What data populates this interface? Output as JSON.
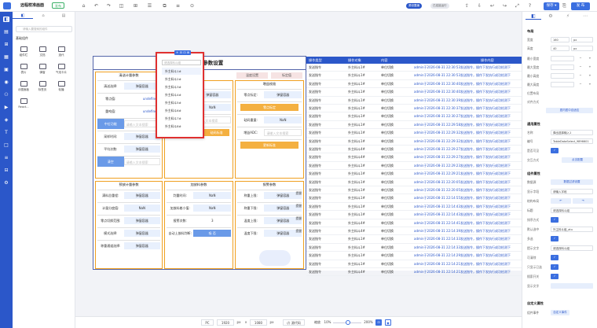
{
  "topbar": {
    "title": "远程校准画面",
    "badge": "发布",
    "view_label": "源设置编",
    "mode_label": "已连接运行",
    "save_label": "保存 ▾",
    "publish_label": "发 布"
  },
  "panel": {
    "search_placeholder": "请输入要搜索的组件",
    "section": "基础组件",
    "items": [
      "组件栏",
      "文档",
      "选代",
      "表片",
      "弹窗",
      "气泡卡片",
      "示图面板",
      "标签页",
      "轮播",
      "React..."
    ]
  },
  "frame": {
    "title": "称重标准与参数设置",
    "boxes": {
      "clear": {
        "title": "清送计量参数",
        "rows": [
          {
            "label": "清送选择:",
            "value": "弹窗容器",
            "style": "blue"
          },
          {
            "label": "零点值:",
            "value": "undefined",
            "style": "undef"
          },
          {
            "label": "重吨值:",
            "value": "undefined",
            "style": "undef"
          },
          {
            "label": "中位功能",
            "value": "请输入文本搜索",
            "style": "input",
            "lab": "blue"
          },
          {
            "label": "采样时间:",
            "value": "弹窗容器",
            "style": "blue"
          },
          {
            "label": "平均次数:",
            "value": "弹窗容器",
            "style": "blue"
          },
          {
            "label": "清空",
            "value": "请输入文本搜索",
            "style": "input",
            "lab": "blue"
          }
        ]
      },
      "mid": {
        "title": "过标准",
        "rows": [
          {
            "label": "",
            "value": "弹窗容器",
            "style": "blue"
          },
          {
            "label": "砝码重量:",
            "value": "NaN",
            "style": "blue"
          },
          {
            "label": "砝码ADC:",
            "value": "请输入文本搜索",
            "style": "input"
          },
          {
            "label": "零点标定",
            "value": "砝码标准",
            "style": "pair"
          }
        ]
      },
      "span": {
        "title": "增益校准",
        "rows": [
          {
            "label": "零点标定:",
            "value": "弹窗容器",
            "style": "blue"
          },
          {
            "label": "零点标定",
            "value": "",
            "style": "orangebar"
          },
          {
            "label": "砝码重量:",
            "value": "NaN",
            "style": "blue"
          },
          {
            "label": "增益ADC:",
            "value": "请输入文本搜索",
            "style": "input"
          },
          {
            "label": "更新标准",
            "value": "",
            "style": "orangebar"
          }
        ]
      },
      "pre": {
        "title": "预放计量参数",
        "rows": [
          {
            "label": "满料总重程:",
            "value": "弹窗容器",
            "style": "blue"
          },
          {
            "label": "计量分度值:",
            "value": "NaN",
            "style": "blue"
          },
          {
            "label": "零点切换范围:",
            "value": "弹窗容器",
            "style": "blue"
          },
          {
            "label": "模式选择:",
            "value": "弹窗容器",
            "style": "blue"
          },
          {
            "label": "称重通道选择:",
            "value": "弹窗容器",
            "style": "blue"
          }
        ]
      },
      "add": {
        "title": "加放料参数",
        "rows": [
          {
            "label": "判重时间:",
            "value": "NaN",
            "style": "blue"
          },
          {
            "label": "加放料着小值:",
            "value": "NaN",
            "style": "blue"
          },
          {
            "label": "报警次数:",
            "value": "3",
            "style": "plain"
          },
          {
            "label": "自动上放料判断:",
            "value": "吸 否",
            "style": "solid"
          }
        ]
      },
      "alarm": {
        "title": "报警参数",
        "rows": [
          {
            "label": "称重上限:",
            "value": "弹窗容器",
            "style": "blue"
          },
          {
            "label": "称重下限:",
            "value": "弹窗容器",
            "style": "blue"
          },
          {
            "label": "温度上限:",
            "value": "弹窗容器",
            "style": "blue"
          },
          {
            "label": "温度下限:",
            "value": "弹窗容器",
            "style": "blue"
          }
        ]
      }
    },
    "side_labels": [
      "提醒",
      "提醒",
      "提醒",
      "提醒",
      "提醒"
    ],
    "chip_labels": [
      "温度设置",
      "标定值"
    ]
  },
  "dropdown": {
    "toolbar": "+ ⊟ ⊡ ⊞",
    "search": "请选择料斗组",
    "items": [
      "外主料斗1#",
      "外主料斗2#",
      "外主料斗3#",
      "外主料斗4#",
      "外主料斗5#",
      "外主料斗6#",
      "外主料斗7#",
      "外主料斗8#"
    ]
  },
  "table": {
    "headers": [
      "操作类型",
      "操作对象",
      "内容",
      "",
      "操作内容"
    ],
    "rows": [
      [
        "发送指令",
        "外主料斗1#",
        "单位切换",
        "admin于2026-08-31 22:30:53发送指令，操作下发执行成功检测下"
      ],
      [
        "发送指令",
        "外主料斗1#",
        "单位切换",
        "admin于2026-08-31 22:30:53发送指令，操作下发执行成功检测下"
      ],
      [
        "发送指令",
        "外主料斗1#",
        "单位切换",
        "admin于2026-08-31 22:30:40发送指令，操作下发执行成功检测下"
      ],
      [
        "发送指令",
        "外主料斗1#",
        "单位切换",
        "admin于2026-08-31 22:30:40发送指令，操作下发执行成功检测下"
      ],
      [
        "发送指令",
        "外主料斗1#",
        "单位切换",
        "admin于2026-08-31 22:30:39发送指令，操作下发执行成功检测下"
      ],
      [
        "发送指令",
        "外主料斗1#",
        "单位切换",
        "admin于2026-08-31 22:30:37发送指令，操作下发执行成功检测下"
      ],
      [
        "发送指令",
        "外主料斗1#",
        "单位切换",
        "admin于2026-08-31 22:30:27发送指令，操作下发执行成功检测下"
      ],
      [
        "发送指令",
        "外主料斗1#",
        "单位切换",
        "admin于2026-08-31 22:29:58发送指令，操作下发执行成功检测下"
      ],
      [
        "发送指令",
        "外主料斗1#",
        "单位切换",
        "admin于2026-08-31 22:29:32发送指令，操作下发执行成功检测下"
      ],
      [
        "发送指令",
        "外主料斗1#",
        "单位切换",
        "admin于2026-08-31 22:29:32发送指令，操作下发执行成功检测下"
      ],
      [
        "发送指令",
        "外主料斗4#",
        "单位切换",
        "admin于2026-08-31 22:29:27发送指令，操作下发执行成功检测下"
      ],
      [
        "发送指令",
        "外主料斗4#",
        "单位切换",
        "admin于2026-08-31 22:29:27发送指令，操作下发执行成功检测下"
      ],
      [
        "发送指令",
        "外主料斗1#",
        "单位切换",
        "admin于2026-08-31 22:29:23发送指令，操作下发执行成功检测下"
      ],
      [
        "发送指令",
        "外主料斗1#",
        "单位切换",
        "admin于2026-08-31 22:29:21发送指令，操作下发执行成功检测下"
      ],
      [
        "发送指令",
        "外主料斗1#",
        "单位切换",
        "admin于2026-08-31 22:20:05发送指令，操作下发执行成功检测下"
      ],
      [
        "发送指令",
        "外主料斗1#",
        "单位切换",
        "admin于2026-08-31 22:20:05发送指令，操作下发执行成功检测下"
      ],
      [
        "发送指令",
        "外主料斗1#",
        "单位切换",
        "admin于2026-08-31 22:14:55发送指令，操作下发执行成功检测下"
      ],
      [
        "发送指令",
        "外主料斗1#",
        "单位切换",
        "admin于2026-08-31 22:14:43发送指令，操作下发执行成功检测下"
      ],
      [
        "发送指令",
        "外主料斗1#",
        "单位切换",
        "admin于2026-08-31 22:14:43发送指令，操作下发执行成功检测下"
      ],
      [
        "发送指令",
        "外主料斗4#",
        "单位切换",
        "admin于2026-08-31 22:14:41发送指令，操作下发执行成功检测下"
      ],
      [
        "发送指令",
        "外主料斗4#",
        "单位切换",
        "admin于2026-08-31 22:14:39发送指令，操作下发执行成功检测下"
      ],
      [
        "发送指令",
        "外主料斗1#",
        "单位切换",
        "admin于2026-08-31 22:14:33发送指令，操作下发执行成功检测下"
      ],
      [
        "发送指令",
        "外主料斗1#",
        "单位切换",
        "admin于2026-08-31 22:14:33发送指令，操作下发执行成功检测下"
      ],
      [
        "发送指令",
        "外主料斗1#",
        "单位切换",
        "admin于2026-08-31 22:14:29发送指令，操作下发执行成功检测下"
      ],
      [
        "发送指令",
        "外主料斗1#",
        "单位切换",
        "admin于2026-08-31 22:14:21发送指令，操作下发执行成功检测下"
      ],
      [
        "发送指令",
        "外主料斗4#",
        "单位切换",
        "admin于2026-08-31 22:14:21发送指令，操作下发执行成功检测下"
      ]
    ]
  },
  "bottom": {
    "device": "PC",
    "width": "1920",
    "unit1": "px",
    "height": "1080",
    "unit2": "px",
    "code": "源代码",
    "zoom_label": "缩放",
    "zoom_min": "10%",
    "zoom_max": "200%"
  },
  "props": {
    "layout": "布局",
    "width_label": "宽度",
    "width": "160",
    "width_unit": "px",
    "height_label": "高度",
    "height": "40",
    "height_unit": "px",
    "rows": [
      "最小宽度",
      "最大宽度",
      "最小高度",
      "最大高度",
      "位置布局",
      "对齐方式"
    ],
    "align_btn": "居内居中自适应",
    "general": "通用属性",
    "name_label": "名称",
    "name": "弹出选择输入1",
    "id_label": "编号",
    "id": "TableDataSelect_9896601",
    "visible_label": "是否可见",
    "trigger_label": "交互方式",
    "trigger": "点击配置",
    "data": "组件属性",
    "source_label": "数据源",
    "source": "数据过滤设置",
    "show_label": "显示字段",
    "show": "请输入字段",
    "format_label": "结构布局",
    "placeholder_label": "标题",
    "placeholder": "请选择料斗组",
    "sort_label": "排序方式",
    "item_label": "默认选中",
    "item": "外主料斗组_atu",
    "multi_label": "多选",
    "tips_label": "提示文字",
    "tips": "请选择料斗组",
    "clear_label": "可清除",
    "fixed_label": "只显示已选",
    "search_label": "搜索开关",
    "hidden_label": "显示文字",
    "group": "自定义属性",
    "event_label": "组件事件",
    "event": "自定义事件"
  }
}
